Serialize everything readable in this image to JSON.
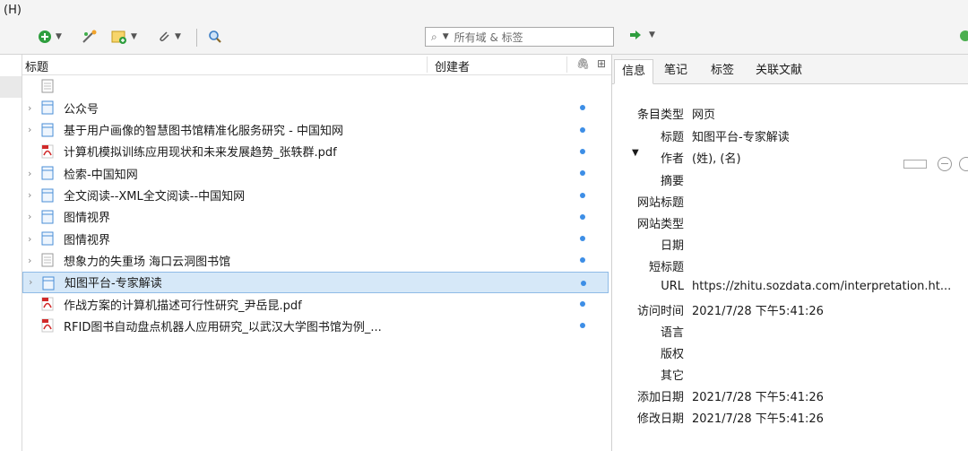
{
  "menu": {
    "help": "(H)"
  },
  "toolbar": {
    "search_placeholder": "所有域 & 标签"
  },
  "table": {
    "col_title": "标题",
    "col_creator": "创建者",
    "rows": [
      {
        "title": "",
        "type": "note",
        "expand": false,
        "dot": false,
        "selected": false
      },
      {
        "title": "公众号",
        "type": "doc",
        "expand": true,
        "dot": true,
        "selected": false
      },
      {
        "title": "基于用户画像的智慧图书馆精准化服务研究 - 中国知网",
        "type": "doc",
        "expand": true,
        "dot": true,
        "selected": false
      },
      {
        "title": "计算机模拟训练应用现状和未来发展趋势_张轶群.pdf",
        "type": "pdf",
        "expand": false,
        "dot": true,
        "selected": false
      },
      {
        "title": "检索-中国知网",
        "type": "doc",
        "expand": true,
        "dot": true,
        "selected": false
      },
      {
        "title": "全文阅读--XML全文阅读--中国知网",
        "type": "doc",
        "expand": true,
        "dot": true,
        "selected": false
      },
      {
        "title": "图情视界",
        "type": "doc",
        "expand": true,
        "dot": true,
        "selected": false
      },
      {
        "title": "图情视界",
        "type": "doc",
        "expand": true,
        "dot": true,
        "selected": false
      },
      {
        "title": "想象力的失重场 海口云洞图书馆",
        "type": "note",
        "expand": true,
        "dot": true,
        "selected": false
      },
      {
        "title": "知图平台-专家解读",
        "type": "doc",
        "expand": true,
        "dot": true,
        "selected": true
      },
      {
        "title": "作战方案的计算机描述可行性研究_尹岳昆.pdf",
        "type": "pdf",
        "expand": false,
        "dot": true,
        "selected": false
      },
      {
        "title": "RFID图书自动盘点机器人应用研究_以武汉大学图书馆为例_...",
        "type": "pdf",
        "expand": false,
        "dot": true,
        "selected": false
      }
    ]
  },
  "tabs": [
    "信息",
    "笔记",
    "标签",
    "关联文献"
  ],
  "info": {
    "item_type_label": "条目类型",
    "item_type": "网页",
    "title_label": "标题",
    "title": "知图平台-专家解读",
    "author_label": "作者",
    "author": "(姓), (名)",
    "abstract_label": "摘要",
    "site_title_label": "网站标题",
    "site_type_label": "网站类型",
    "date_label": "日期",
    "short_title_label": "短标题",
    "url_label": "URL",
    "url": "https://zhitu.sozdata.com/interpretation.ht...",
    "access_label": "访问时间",
    "access": "2021/7/28 下午5:41:26",
    "language_label": "语言",
    "rights_label": "版权",
    "extra_label": "其它",
    "added_label": "添加日期",
    "added": "2021/7/28 下午5:41:26",
    "modified_label": "修改日期",
    "modified": "2021/7/28 下午5:41:26"
  }
}
